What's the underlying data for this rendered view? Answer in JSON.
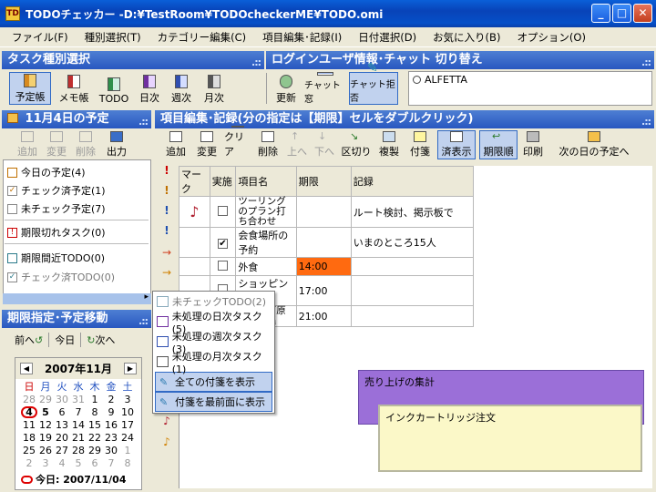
{
  "window": {
    "title": "TODOチェッカー -D:¥TestRoom¥TODOcheckerME¥TODO.omi",
    "icon_text": "TD",
    "buttons": {
      "minimize": "_",
      "maximize": "□",
      "close": "✕"
    }
  },
  "menu": [
    "ファイル(F)",
    "種別選択(T)",
    "カテゴリー編集(C)",
    "項目編集･記録(I)",
    "日付選択(D)",
    "お気に入り(B)",
    "オプション(O)"
  ],
  "task_type_header": "タスク種別選択",
  "login_header": "ログインユーザ情報･チャット 切り替え",
  "task_types": [
    {
      "label": "予定帳",
      "icon": "book-icon"
    },
    {
      "label": "メモ帳",
      "icon": "memo-icon"
    },
    {
      "label": "TODO",
      "icon": "todo-icon"
    },
    {
      "label": "日次",
      "icon": "daily-icon"
    },
    {
      "label": "週次",
      "icon": "weekly-icon"
    },
    {
      "label": "月次",
      "icon": "monthly-icon"
    }
  ],
  "login_tools": {
    "refresh": "更新",
    "chat_window": "チャット窓",
    "chat_reject": "チャット拒否"
  },
  "user": "ALFETTA",
  "schedule_header": "11月4日の予定",
  "left_tools": {
    "add": "追加",
    "edit": "変更",
    "delete": "削除",
    "output": "出力"
  },
  "left_list": [
    {
      "label": "今日の予定(4)",
      "gray": false
    },
    {
      "label": "チェック済予定(1)",
      "gray": false
    },
    {
      "label": "未チェック予定(7)",
      "gray": false
    },
    {
      "label": "期限切れタスク(0)",
      "gray": false
    },
    {
      "label": "期限間近TODO(0)",
      "gray": false
    },
    {
      "label": "チェック済TODO(0)",
      "gray": true
    }
  ],
  "edit_header": "項目編集･記録(分の指定は【期限】セルをダブルクリック)",
  "edit_tools": {
    "add": "追加",
    "edit": "変更",
    "clear": "クリア",
    "delete": "削除",
    "up": "上へ",
    "down": "下へ",
    "split": "区切り",
    "copy": "複製",
    "sticky": "付箋",
    "show_done": "済表示",
    "by_due": "期限順",
    "print": "印刷",
    "next_day": "次の日の予定へ"
  },
  "table": {
    "headers": [
      "マーク",
      "実施",
      "項目名",
      "期限",
      "記録"
    ],
    "rows": [
      {
        "mark": "♪",
        "done": "",
        "name": "ツーリングのプラン打ち合わせ",
        "due": "",
        "record": "ルート検討、掲示板で"
      },
      {
        "mark": "",
        "done": "✔",
        "name": "会食場所の予約",
        "due": "",
        "record": "いまのところ15人"
      },
      {
        "mark": "",
        "done": "",
        "name": "外食",
        "due": "14:00",
        "record": ""
      },
      {
        "mark": "",
        "done": "",
        "name": "ショッピング",
        "due": "17:00",
        "record": ""
      },
      {
        "mark": "!",
        "done": "",
        "name": "メルマガ原稿の編集",
        "due": "21:00",
        "record": ""
      }
    ]
  },
  "popup": [
    {
      "label": "未チェックTODO(2)",
      "gray": true
    },
    {
      "label": "未処理の日次タスク(5)",
      "gray": false
    },
    {
      "label": "未処理の週次タスク(3)",
      "gray": false
    },
    {
      "label": "未処理の月次タスク(1)",
      "gray": false
    },
    {
      "label": "全ての付箋を表示",
      "gray": false
    },
    {
      "label": "付箋を最前面に表示",
      "gray": false
    }
  ],
  "due_header": "期限指定･予定移動",
  "nav": {
    "prev": "前へ",
    "today": "今日",
    "next": "次へ"
  },
  "calendar": {
    "month": "2007年11月",
    "weekdays": [
      "日",
      "月",
      "火",
      "水",
      "木",
      "金",
      "土"
    ],
    "days": [
      "28",
      "29",
      "30",
      "31",
      "1",
      "2",
      "3",
      "4",
      "5",
      "6",
      "7",
      "8",
      "9",
      "10",
      "11",
      "12",
      "13",
      "14",
      "15",
      "16",
      "17",
      "18",
      "19",
      "20",
      "21",
      "22",
      "23",
      "24",
      "25",
      "26",
      "27",
      "28",
      "29",
      "30",
      "1",
      "2",
      "3",
      "4",
      "5",
      "6",
      "7",
      "8"
    ],
    "today_label": "今日: 2007/11/04"
  },
  "notes": [
    {
      "text": "売り上げの集計",
      "color": "#9b6fd8"
    },
    {
      "text": "インクカートリッジ注文",
      "color": "#fbf8c8"
    }
  ]
}
